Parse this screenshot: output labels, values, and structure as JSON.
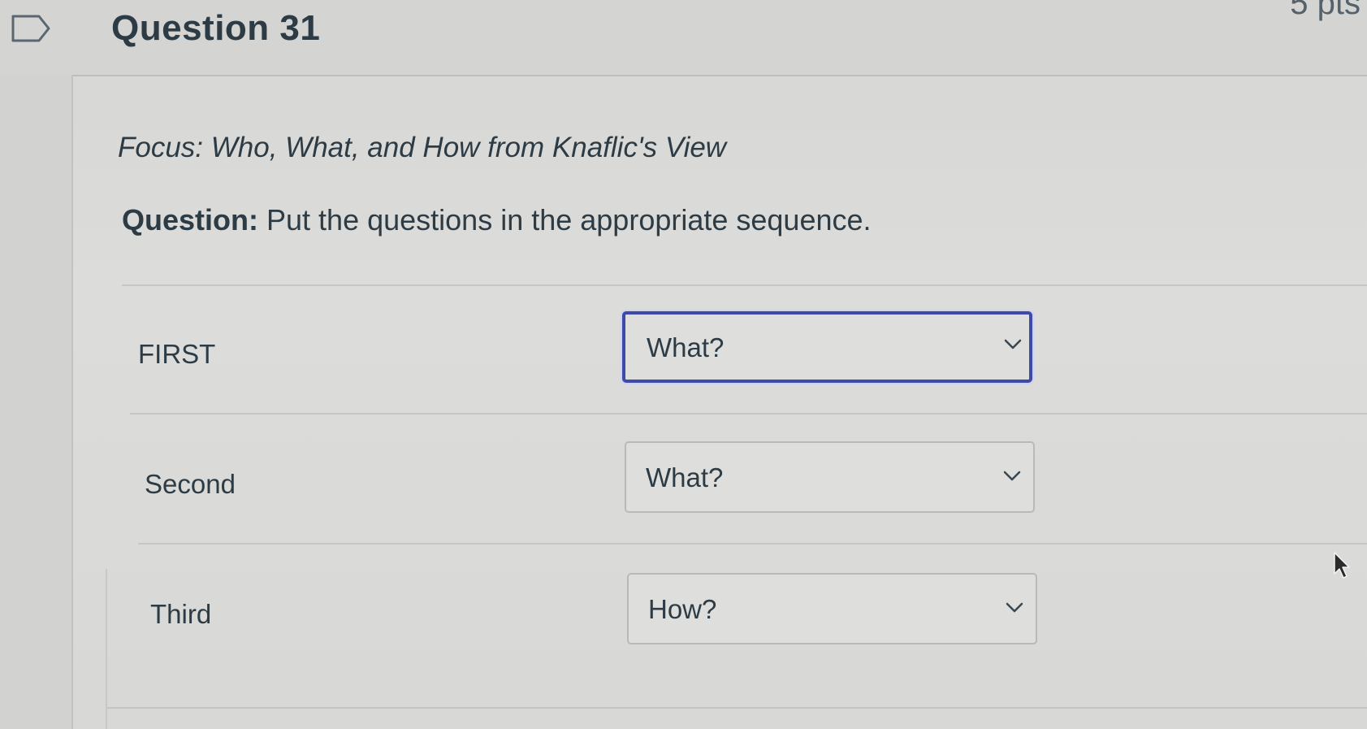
{
  "header": {
    "question_title": "Question 31",
    "points": "5 pts"
  },
  "content": {
    "focus_text": "Focus: Who, What, and How from Knaflic's View",
    "question_prefix": "Question:",
    "question_text": " Put the questions in the appropriate sequence."
  },
  "rows": [
    {
      "label": "FIRST",
      "selected": "What?"
    },
    {
      "label": "Second",
      "selected": "What?"
    },
    {
      "label": "Third",
      "selected": "How?"
    }
  ],
  "colors": {
    "focus_border": "#3f49a8",
    "text": "#2d3b45"
  },
  "icons": {
    "flag": "flag-question-icon",
    "dropdown": "chevron-down-icon",
    "cursor": "mouse-pointer-icon"
  }
}
